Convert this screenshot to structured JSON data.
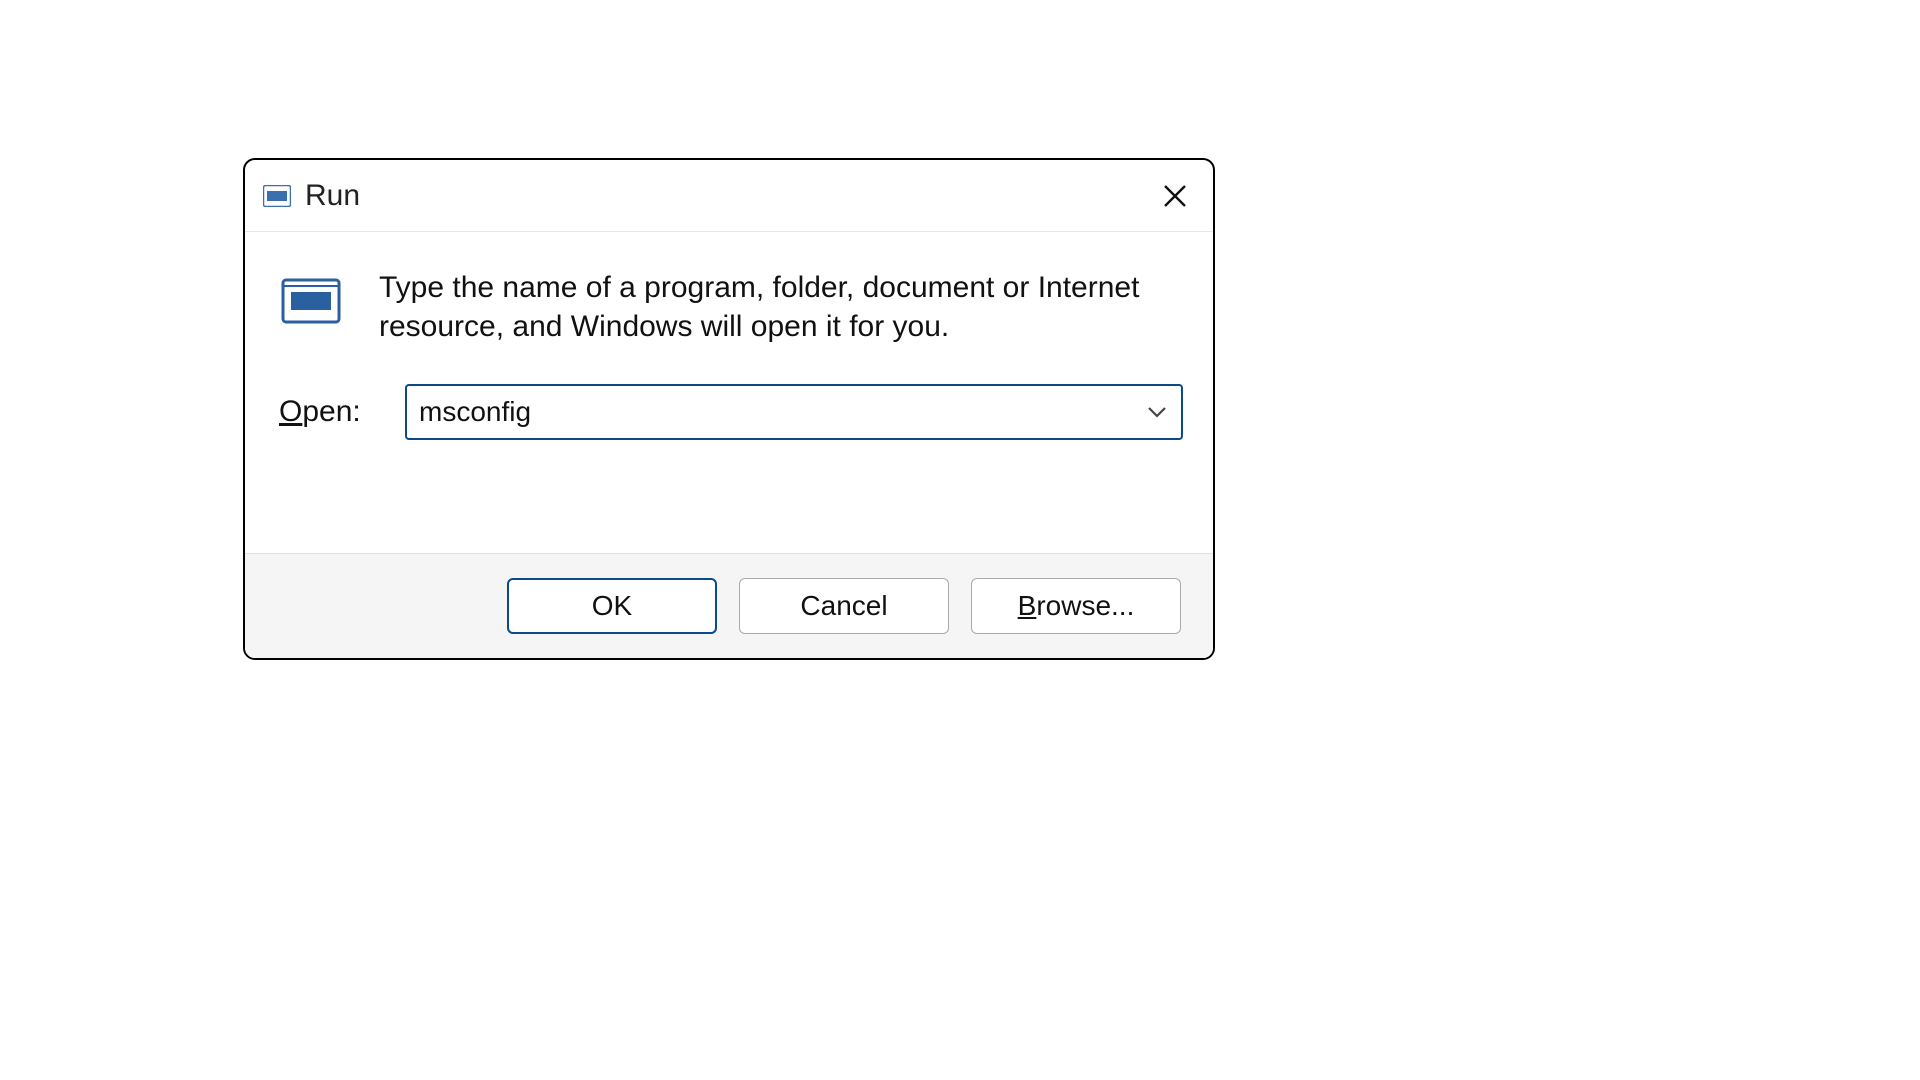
{
  "window": {
    "title": "Run"
  },
  "description": "Type the name of a program, folder, document or Internet resource, and Windows will open it for you.",
  "open_label_pre": "O",
  "open_label_post": "pen:",
  "input_value": "msconfig",
  "buttons": {
    "ok": "OK",
    "cancel": "Cancel",
    "browse_u": "B",
    "browse_rest": "rowse..."
  }
}
